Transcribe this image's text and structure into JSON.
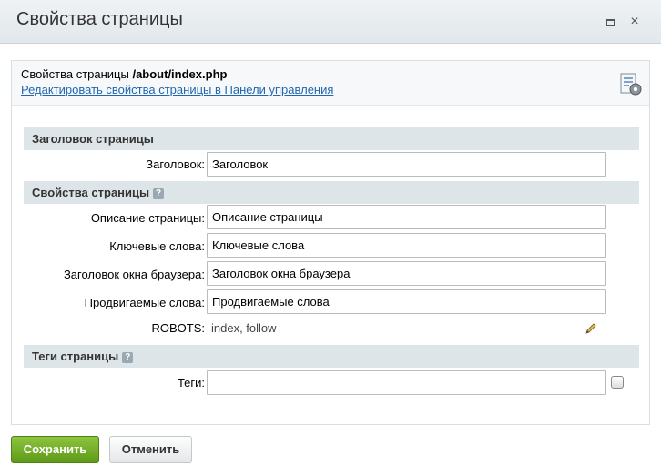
{
  "dialog": {
    "title": "Свойства страницы",
    "maximize_icon": "maximize-icon",
    "close_icon": "close-icon",
    "close_glyph": "×"
  },
  "info": {
    "prefix": "Свойства страницы ",
    "path": "/about/index.php",
    "edit_link": "Редактировать свойства страницы в Панели управления",
    "settings_icon": "page-settings-icon"
  },
  "sections": {
    "page_title": "Заголовок страницы",
    "page_properties": "Свойства страницы",
    "page_tags": "Теги страницы",
    "help_glyph": "?"
  },
  "fields": {
    "title": {
      "label": "Заголовок:",
      "value": "Заголовок"
    },
    "description": {
      "label": "Описание страницы:",
      "value": "Описание страницы"
    },
    "keywords": {
      "label": "Ключевые слова:",
      "value": "Ключевые слова"
    },
    "browser_title": {
      "label": "Заголовок окна браузера:",
      "value": "Заголовок окна браузера"
    },
    "promoted_words": {
      "label": "Продвигаемые слова:",
      "value": "Продвигаемые слова"
    },
    "robots": {
      "label": "ROBOTS:",
      "value": "index, follow"
    },
    "tags": {
      "label": "Теги:",
      "value": ""
    }
  },
  "buttons": {
    "save": "Сохранить",
    "cancel": "Отменить"
  },
  "colors": {
    "save_button": "#6fac25",
    "link": "#2067b0",
    "section_header": "#dde5e8"
  }
}
